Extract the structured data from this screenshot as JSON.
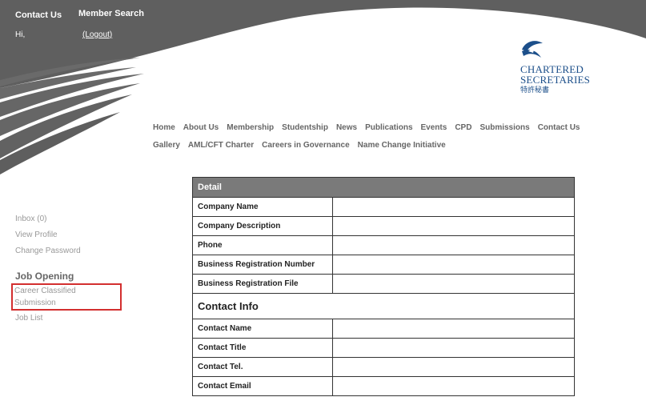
{
  "top_links": {
    "contact_us": "Contact Us",
    "member_search": "Member Search"
  },
  "greeting": "Hi,",
  "logout": "(Logout)",
  "logo": {
    "line1": "CHARTERED",
    "line2": "SECRETARIES",
    "chinese": "特許秘書"
  },
  "nav_row1": [
    "Home",
    "About Us",
    "Membership",
    "Studentship",
    "News",
    "Publications",
    "Events",
    "CPD",
    "Submissions",
    "Contact Us"
  ],
  "nav_row2": [
    "Gallery",
    "AML/CFT Charter",
    "Careers in Governance",
    "Name Change Initiative"
  ],
  "sidebar": {
    "links": [
      "Inbox (0)",
      "View Profile",
      "Change Password"
    ],
    "heading": "Job Opening",
    "job_links": [
      "Career Classified Submission",
      "Job List"
    ]
  },
  "form": {
    "header": "Detail",
    "detail_rows": [
      "Company Name",
      "Company Description",
      "Phone",
      "Business Registration Number",
      "Business Registration File"
    ],
    "contact_section": "Contact Info",
    "contact_rows": [
      "Contact Name",
      "Contact Title",
      "Contact Tel.",
      "Contact Email"
    ]
  },
  "colors": {
    "header_gray": "#5f5f5f",
    "logo_blue": "#1c4f8a",
    "highlight_red": "#d32f2f"
  }
}
